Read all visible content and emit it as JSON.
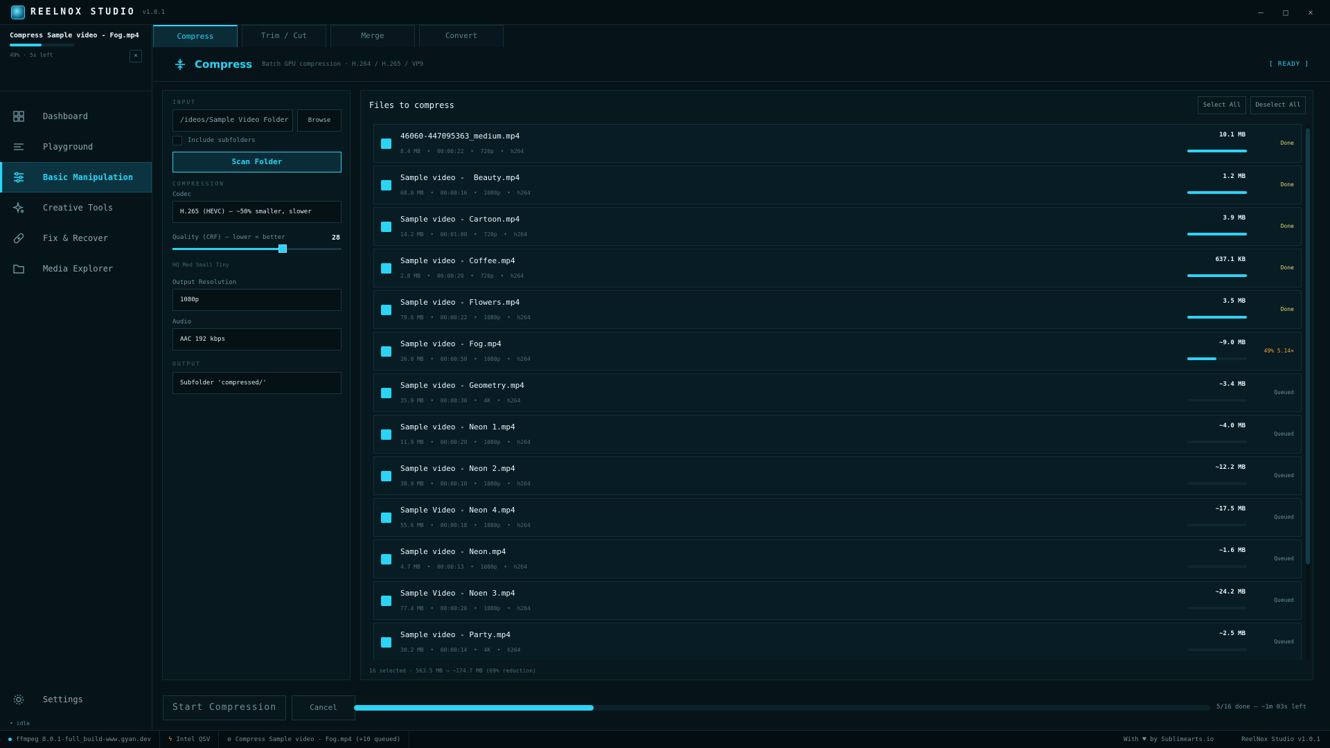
{
  "app": {
    "name": "REELNOX STUDIO",
    "version": "v1.0.1"
  },
  "window_controls": [
    "–",
    "□",
    "×"
  ],
  "job": {
    "title": "Compress Sample video - Fog.mp4",
    "progress": 0.49,
    "meta": "49%  ·  5s left",
    "close": "×"
  },
  "sidebar": {
    "items": [
      {
        "label": "Dashboard",
        "icon": "dashboard-icon"
      },
      {
        "label": "Playground",
        "icon": "playground-icon"
      },
      {
        "label": "Basic Manipulation",
        "icon": "sliders-icon"
      },
      {
        "label": "Creative Tools",
        "icon": "sparkle-icon"
      },
      {
        "label": "Fix & Recover",
        "icon": "bandage-icon"
      },
      {
        "label": "Media Explorer",
        "icon": "folder-icon"
      }
    ],
    "active_index": 2,
    "settings_label": "Settings",
    "idle": "• idle"
  },
  "tabs": [
    "Compress",
    "Trim / Cut",
    "Merge",
    "Convert"
  ],
  "header": {
    "title": "Compress",
    "subtitle": "Batch GPU compression · H.264 / H.265 / VP9",
    "status": "[ READY ]"
  },
  "input": {
    "section": "INPUT",
    "path": "/ideos/Sample Video Folder",
    "browse": "Browse",
    "include_subfolders": "Include subfolders",
    "scan": "Scan Folder"
  },
  "compression": {
    "section": "COMPRESSION",
    "codec_label": "Codec",
    "codec_value": "H.265 (HEVC) — ~50% smaller, slower",
    "quality_label": "Quality (CRF)  —  lower = better",
    "quality_value": "28",
    "quality_fraction": 0.65,
    "presets": "HQ Med Small Tiny",
    "resolution_label": "Output Resolution",
    "resolution_value": "1080p",
    "audio_label": "Audio",
    "audio_value": "AAC 192 kbps"
  },
  "output": {
    "section": "OUTPUT",
    "value": "Subfolder 'compressed/'"
  },
  "files": {
    "title": "Files to compress",
    "select_all": "Select All",
    "deselect_all": "Deselect All",
    "rows": [
      {
        "name": "46060-447095363_medium.mp4",
        "meta": "8.4 MB  •  00:00:22  •  720p  •  h264",
        "size": "10.1 MB",
        "progress": 1.0,
        "status": "Done",
        "kind": "done"
      },
      {
        "name": "Sample video -  Beauty.mp4",
        "meta": "68.0 MB  •  00:00:16  •  1080p  •  h264",
        "size": "1.2 MB",
        "progress": 1.0,
        "status": "Done",
        "kind": "done"
      },
      {
        "name": "Sample video - Cartoon.mp4",
        "meta": "14.2 MB  •  00:01:00  •  720p  •  h264",
        "size": "3.9 MB",
        "progress": 1.0,
        "status": "Done",
        "kind": "done"
      },
      {
        "name": "Sample video - Coffee.mp4",
        "meta": "2.8 MB  •  00:00:20  •  720p  •  h264",
        "size": "637.1 KB",
        "progress": 1.0,
        "status": "Done",
        "kind": "done"
      },
      {
        "name": "Sample video - Flowers.mp4",
        "meta": "79.6 MB  •  00:00:22  •  1080p  •  h264",
        "size": "3.5 MB",
        "progress": 1.0,
        "status": "Done",
        "kind": "done"
      },
      {
        "name": "Sample video - Fog.mp4",
        "meta": "26.0 MB  •  00:00:50  •  1080p  •  h264",
        "size": "~9.0 MB",
        "progress": 0.49,
        "status": "49% 5.14×",
        "kind": "progress"
      },
      {
        "name": "Sample video - Geometry.mp4",
        "meta": "35.9 MB  •  00:00:30  •  4K  •  h264",
        "size": "~3.4 MB",
        "progress": 0,
        "status": "Queued",
        "kind": "queued"
      },
      {
        "name": "Sample video - Neon 1.mp4",
        "meta": "11.9 MB  •  00:00:20  •  1080p  •  h264",
        "size": "~4.0 MB",
        "progress": 0,
        "status": "Queued",
        "kind": "queued"
      },
      {
        "name": "Sample video - Neon 2.mp4",
        "meta": "38.9 MB  •  00:00:10  •  1080p  •  h264",
        "size": "~12.2 MB",
        "progress": 0,
        "status": "Queued",
        "kind": "queued"
      },
      {
        "name": "Sample Video - Neon 4.mp4",
        "meta": "55.6 MB  •  00:00:18  •  1080p  •  h264",
        "size": "~17.5 MB",
        "progress": 0,
        "status": "Queued",
        "kind": "queued"
      },
      {
        "name": "Sample video - Neon.mp4",
        "meta": "4.7 MB  •  00:00:13  •  1080p  •  h264",
        "size": "~1.6 MB",
        "progress": 0,
        "status": "Queued",
        "kind": "queued"
      },
      {
        "name": "Sample Video - Noen 3.mp4",
        "meta": "77.4 MB  •  00:00:20  •  1080p  •  h264",
        "size": "~24.2 MB",
        "progress": 0,
        "status": "Queued",
        "kind": "queued"
      },
      {
        "name": "Sample video - Party.mp4",
        "meta": "30.2 MB  •  00:00:14  •  4K  •  h264",
        "size": "~2.5 MB",
        "progress": 0,
        "status": "Queued",
        "kind": "queued"
      }
    ],
    "summary": "16 selected  ·  563.5 MB → ~174.7 MB  (69% reduction)"
  },
  "bottom": {
    "start": "Start Compression",
    "cancel": "Cancel",
    "progress": 0.28,
    "progress_text": "5/16 done  —  ~1m 03s left"
  },
  "statusbar": {
    "ffmpeg": "ffmpeg 8.0.1-full_build-www.gyan.dev",
    "gpu": "Intel QSV",
    "job": "Compress Sample video - Fog.mp4  (+10 queued)",
    "credit": "With ♥ by Sublimearts.io",
    "version": "ReelNox Studio v1.0.1"
  },
  "colors": {
    "accent": "#2ad4f5",
    "done": "#e4d87a",
    "in_progress": "#f0a040",
    "background": "#06141a"
  }
}
